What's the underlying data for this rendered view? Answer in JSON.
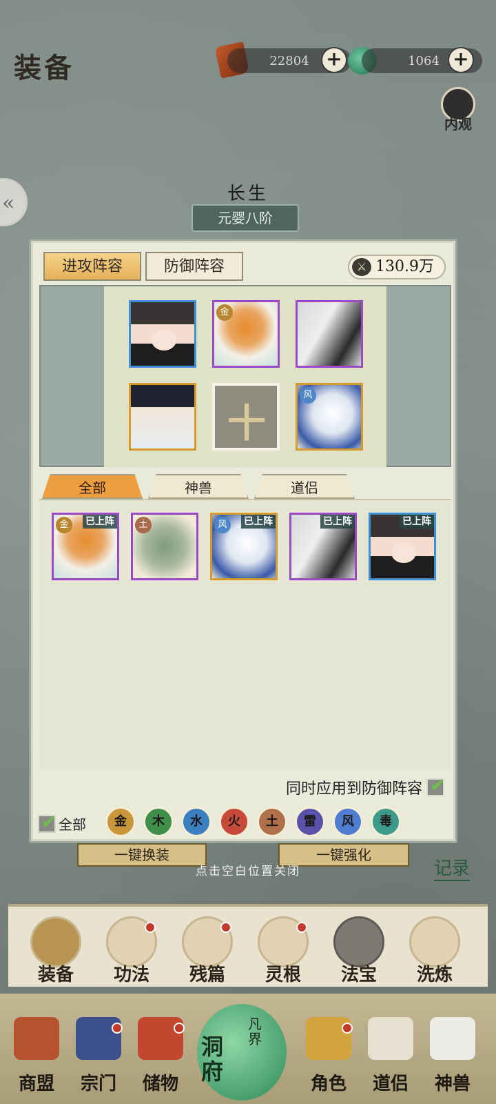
{
  "header": {
    "title": "装备",
    "spirit_stones": "22804",
    "jade": "1064",
    "inner_view_label": "内观"
  },
  "character": {
    "name": "长生",
    "realm": "元婴八阶"
  },
  "panel": {
    "tabs": [
      {
        "label": "进攻阵容",
        "active": true
      },
      {
        "label": "防御阵容",
        "active": false
      }
    ],
    "power": "130.9万",
    "formation": [
      {
        "type": "girl",
        "frame": "blue",
        "element": ""
      },
      {
        "type": "dragon",
        "frame": "purple",
        "element": "金"
      },
      {
        "type": "elder",
        "frame": "purple",
        "element": ""
      },
      {
        "type": "youth",
        "frame": "gold",
        "element": ""
      },
      {
        "type": "empty",
        "frame": "empty",
        "element": "",
        "placeholder": "十"
      },
      {
        "type": "bird",
        "frame": "gold",
        "element": "风"
      }
    ],
    "filter_tabs": [
      {
        "label": "全部",
        "active": true
      },
      {
        "label": "神兽",
        "active": false
      },
      {
        "label": "道侣",
        "active": false
      }
    ],
    "pool": [
      {
        "type": "dragon",
        "frame": "purple",
        "element": "金",
        "status": "已上阵"
      },
      {
        "type": "turtle",
        "frame": "purple",
        "element": "土",
        "status": ""
      },
      {
        "type": "bird",
        "frame": "gold",
        "element": "风",
        "status": "已上阵"
      },
      {
        "type": "elder",
        "frame": "purple",
        "element": "",
        "status": "已上阵"
      },
      {
        "type": "girl",
        "frame": "blue",
        "element": "",
        "status": "已上阵"
      }
    ],
    "apply_defense_label": "同时应用到防御阵容",
    "apply_defense_checked": true,
    "all_filter_label": "全部",
    "elements": [
      {
        "label": "金",
        "color": "#c9973a"
      },
      {
        "label": "木",
        "color": "#3f8f4a"
      },
      {
        "label": "水",
        "color": "#3c7fc0"
      },
      {
        "label": "火",
        "color": "#c84a3a"
      },
      {
        "label": "土",
        "color": "#b0704c"
      },
      {
        "label": "雷",
        "color": "#5a52a8"
      },
      {
        "label": "风",
        "color": "#4e7cd0"
      },
      {
        "label": "毒",
        "color": "#3e9a8a"
      }
    ]
  },
  "background_buttons": {
    "left": "一键换装",
    "right": "一键强化",
    "record": "记录"
  },
  "close_hint": "点击空白位置关闭",
  "subnav": [
    {
      "label": "装备",
      "active": true,
      "dot": false
    },
    {
      "label": "功法",
      "active": false,
      "dot": true
    },
    {
      "label": "残篇",
      "active": false,
      "dot": true
    },
    {
      "label": "灵根",
      "active": false,
      "dot": true
    },
    {
      "label": "法宝",
      "active": false,
      "dot": false
    },
    {
      "label": "洗炼",
      "active": false,
      "dot": false
    }
  ],
  "bottomnav": [
    {
      "label": "商盟",
      "dot": false
    },
    {
      "label": "宗门",
      "dot": true
    },
    {
      "label": "储物",
      "dot": true
    },
    {
      "label": "角色",
      "dot": true
    },
    {
      "label": "道侣",
      "dot": false
    },
    {
      "label": "神兽",
      "dot": false
    }
  ],
  "center_button": {
    "main": "洞府",
    "side": "凡界"
  }
}
